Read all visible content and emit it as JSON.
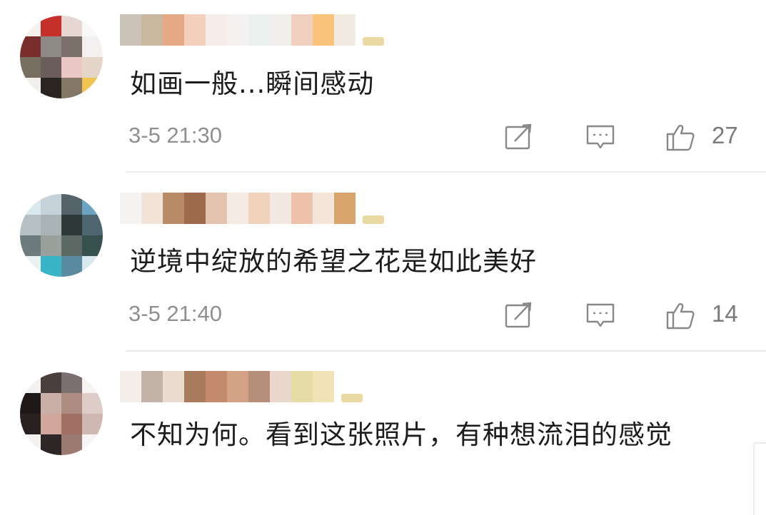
{
  "comments": [
    {
      "text": "如画一般...瞬间感动",
      "time": "3-5 21:30",
      "likes": "27",
      "avatar_colors": [
        "#f5f1ee",
        "#c62f2a",
        "#e7d7d2",
        "#f8f8f8",
        "#7a2e2b",
        "#8e8a86",
        "#7c706a",
        "#f4f0ef",
        "#776f5f",
        "#6a5d5a",
        "#e8c7c5",
        "#e3d5c8",
        "#f0efeb",
        "#2a2521",
        "#837766",
        "#f0c44e"
      ],
      "username_colors": [
        "#ccc3b8",
        "#c9b79f",
        "#e6a985",
        "#f3cfbd",
        "#f6ece9",
        "#f4f2f0",
        "#eaf0ee",
        "#f0eeeb",
        "#f0cfbf",
        "#fbc27a",
        "#f2ebe2"
      ],
      "has_badge": true
    },
    {
      "text": "逆境中绽放的希望之花是如此美好",
      "time": "3-5 21:40",
      "likes": "14",
      "avatar_colors": [
        "#d9e7ee",
        "#c6d2d9",
        "#55636b",
        "#6ba5c3",
        "#b6c0c4",
        "#a9b2b4",
        "#2d3939",
        "#4d6670",
        "#6d7b7c",
        "#9aa19c",
        "#5b6864",
        "#37524e",
        "#eaf2f3",
        "#38b4c6",
        "#5a8ba0",
        "#d8e8ee"
      ],
      "username_colors": [
        "#f4f3f1",
        "#f2e4d8",
        "#b88a65",
        "#9f6b4d",
        "#e4c3ae",
        "#f6ebe3",
        "#f1d2bb",
        "#f2e8e1",
        "#eec1ab",
        "#f5e5d8",
        "#d6a46c"
      ],
      "has_badge": true
    },
    {
      "text": "不知为何。看到这张照片，有种想流泪的感觉",
      "avatar_colors": [
        "#f3f1ef",
        "#4b3f3d",
        "#7b6f70",
        "#f5f4f3",
        "#1f1818",
        "#c9afa8",
        "#ad8c82",
        "#deccc6",
        "#2a2222",
        "#d1a79b",
        "#a16e63",
        "#cfb8b1",
        "#f4f2f1",
        "#2e2727",
        "#9b7a72",
        "#f6f5f4"
      ],
      "username_colors": [
        "#f4eeea",
        "#c2b2a8",
        "#eadbd0",
        "#a97b5e",
        "#c48b6d",
        "#d3a186",
        "#b68f7b",
        "#e8d7ca",
        "#e5dca7",
        "#f1e3b8"
      ],
      "has_badge": true
    }
  ]
}
